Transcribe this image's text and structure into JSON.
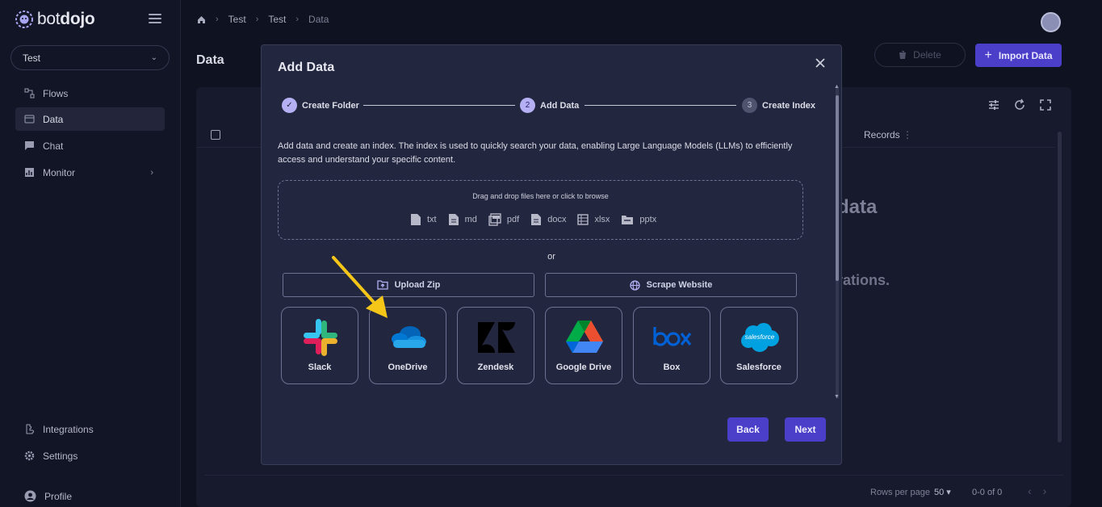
{
  "app": {
    "brand_light": "bot",
    "brand_bold": "dojo",
    "project": "Test"
  },
  "sidebar": {
    "items": [
      {
        "label": "Flows",
        "icon": "flows-icon"
      },
      {
        "label": "Data",
        "icon": "data-icon",
        "active": true
      },
      {
        "label": "Chat",
        "icon": "chat-icon"
      },
      {
        "label": "Monitor",
        "icon": "monitor-icon"
      },
      {
        "label": "Integrations",
        "icon": "integrations-icon"
      },
      {
        "label": "Settings",
        "icon": "settings-icon"
      },
      {
        "label": "Profile",
        "icon": "profile-icon"
      }
    ]
  },
  "breadcrumb": [
    "Test",
    "Test",
    "Data"
  ],
  "header": {
    "title": "Data",
    "delete_label": "Delete",
    "import_label": "Import Data"
  },
  "table": {
    "records_header": "Records",
    "empty_heading_fragment": "data",
    "empty_sub_fragment": "rations.",
    "rows_per_page_label": "Rows per page",
    "rows_per_page_value": "50",
    "range_label": "0-0 of 0"
  },
  "modal": {
    "title": "Add Data",
    "steps": [
      {
        "number": "1",
        "label": "Create Folder",
        "state": "done"
      },
      {
        "number": "2",
        "label": "Add Data",
        "state": "active"
      },
      {
        "number": "3",
        "label": "Create Index",
        "state": "todo"
      }
    ],
    "description": "Add data and create an index. The index is used to quickly search your data, enabling Large Language Models (LLMs) to efficiently access and understand your specific content.",
    "dropzone_text": "Drag and drop files here or click to browse",
    "file_types": [
      "txt",
      "md",
      "pdf",
      "docx",
      "xlsx",
      "pptx"
    ],
    "or_label": "or",
    "upload_zip_label": "Upload Zip",
    "scrape_website_label": "Scrape Website",
    "integrations": [
      "Slack",
      "OneDrive",
      "Zendesk",
      "Google Drive",
      "Box",
      "Salesforce"
    ],
    "salesforce_logo_text": "salesforce",
    "back_label": "Back",
    "next_label": "Next"
  },
  "colors": {
    "accent": "#4b3fc9",
    "background": "#0f1220",
    "modal_bg": "#23263f",
    "arrow": "#f5c518"
  }
}
